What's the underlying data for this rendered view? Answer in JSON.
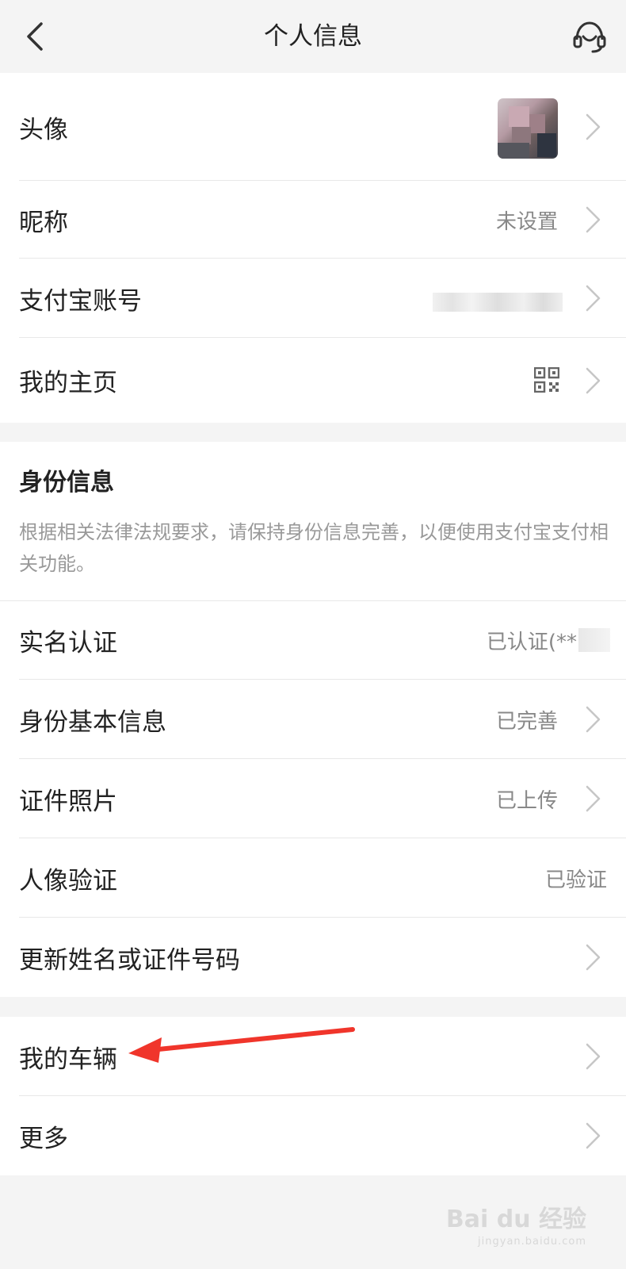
{
  "header": {
    "title": "个人信息"
  },
  "profile": {
    "avatar_label": "头像",
    "nickname_label": "昵称",
    "nickname_value": "未设置",
    "account_label": "支付宝账号",
    "homepage_label": "我的主页"
  },
  "identity": {
    "title": "身份信息",
    "description": "根据相关法律法规要求，请保持身份信息完善，以便使用支付宝支付相关功能。",
    "realname_label": "实名认证",
    "realname_value": "已认证(**",
    "basic_label": "身份基本信息",
    "basic_value": "已完善",
    "photo_label": "证件照片",
    "photo_value": "已上传",
    "face_label": "人像验证",
    "face_value": "已验证",
    "update_label": "更新姓名或证件号码"
  },
  "more": {
    "vehicle_label": "我的车辆",
    "more_label": "更多"
  },
  "watermark": {
    "main": "Bai du 经验",
    "sub": "jingyan.baidu.com"
  },
  "colors": {
    "arrow": "#f0352b",
    "secondary_text": "#888888",
    "background": "#f4f4f4"
  }
}
